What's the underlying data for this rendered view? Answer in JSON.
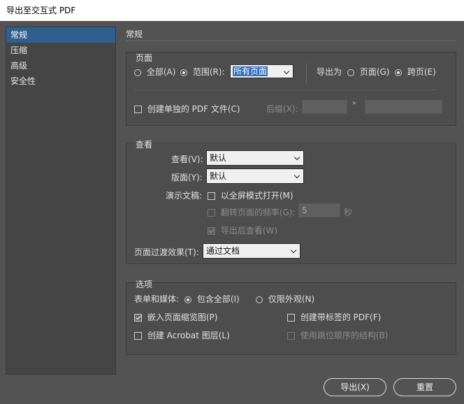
{
  "window": {
    "title": "导出至交互式 PDF"
  },
  "sidebar": {
    "items": [
      {
        "label": "常规",
        "active": true
      },
      {
        "label": "压缩",
        "active": false
      },
      {
        "label": "高级",
        "active": false
      },
      {
        "label": "安全性",
        "active": false
      }
    ]
  },
  "main": {
    "title": "常规"
  },
  "pages": {
    "group_label": "页面",
    "all_label": "全部(A)",
    "range_label": "范围(R):",
    "range_value": "所有页面",
    "export_as_label": "导出为",
    "pages_option": "页面(G)",
    "spreads_option": "跨页(E)",
    "separate_pdf_label": "创建单独的 PDF 文件(C)",
    "suffix_label": "后缀(X):",
    "suffix_arrow": "▸"
  },
  "view": {
    "group_label": "查看",
    "view_label": "查看(V):",
    "view_value": "默认",
    "layout_label": "版面(Y):",
    "layout_value": "默认",
    "presentation_label": "演示文稿:",
    "fullscreen_label": "以全屏模式打开(M)",
    "flip_label": "翻转页面的频率(G):",
    "flip_value": "5",
    "seconds_label": "秒",
    "view_after_label": "导出后查看(W)",
    "transition_label": "页面过渡效果(T):",
    "transition_value": "通过文档"
  },
  "options": {
    "group_label": "选项",
    "forms_label": "表单和媒体:",
    "include_all_label": "包含全部(I)",
    "appearance_only_label": "仅限外观(N)",
    "embed_thumbs_label": "嵌入页面缩览图(P)",
    "tagged_pdf_label": "创建带标签的 PDF(F)",
    "acrobat_layers_label": "创建 Acrobat 图层(L)",
    "tab_order_label": "使用跳位顺序的结构(B)"
  },
  "buttons": {
    "export_label": "导出(X)",
    "reset_label": "重置"
  },
  "colors": {
    "background": "#535353",
    "sidebar_active": "#2e5f8f",
    "selection": "#2f6bbf"
  }
}
